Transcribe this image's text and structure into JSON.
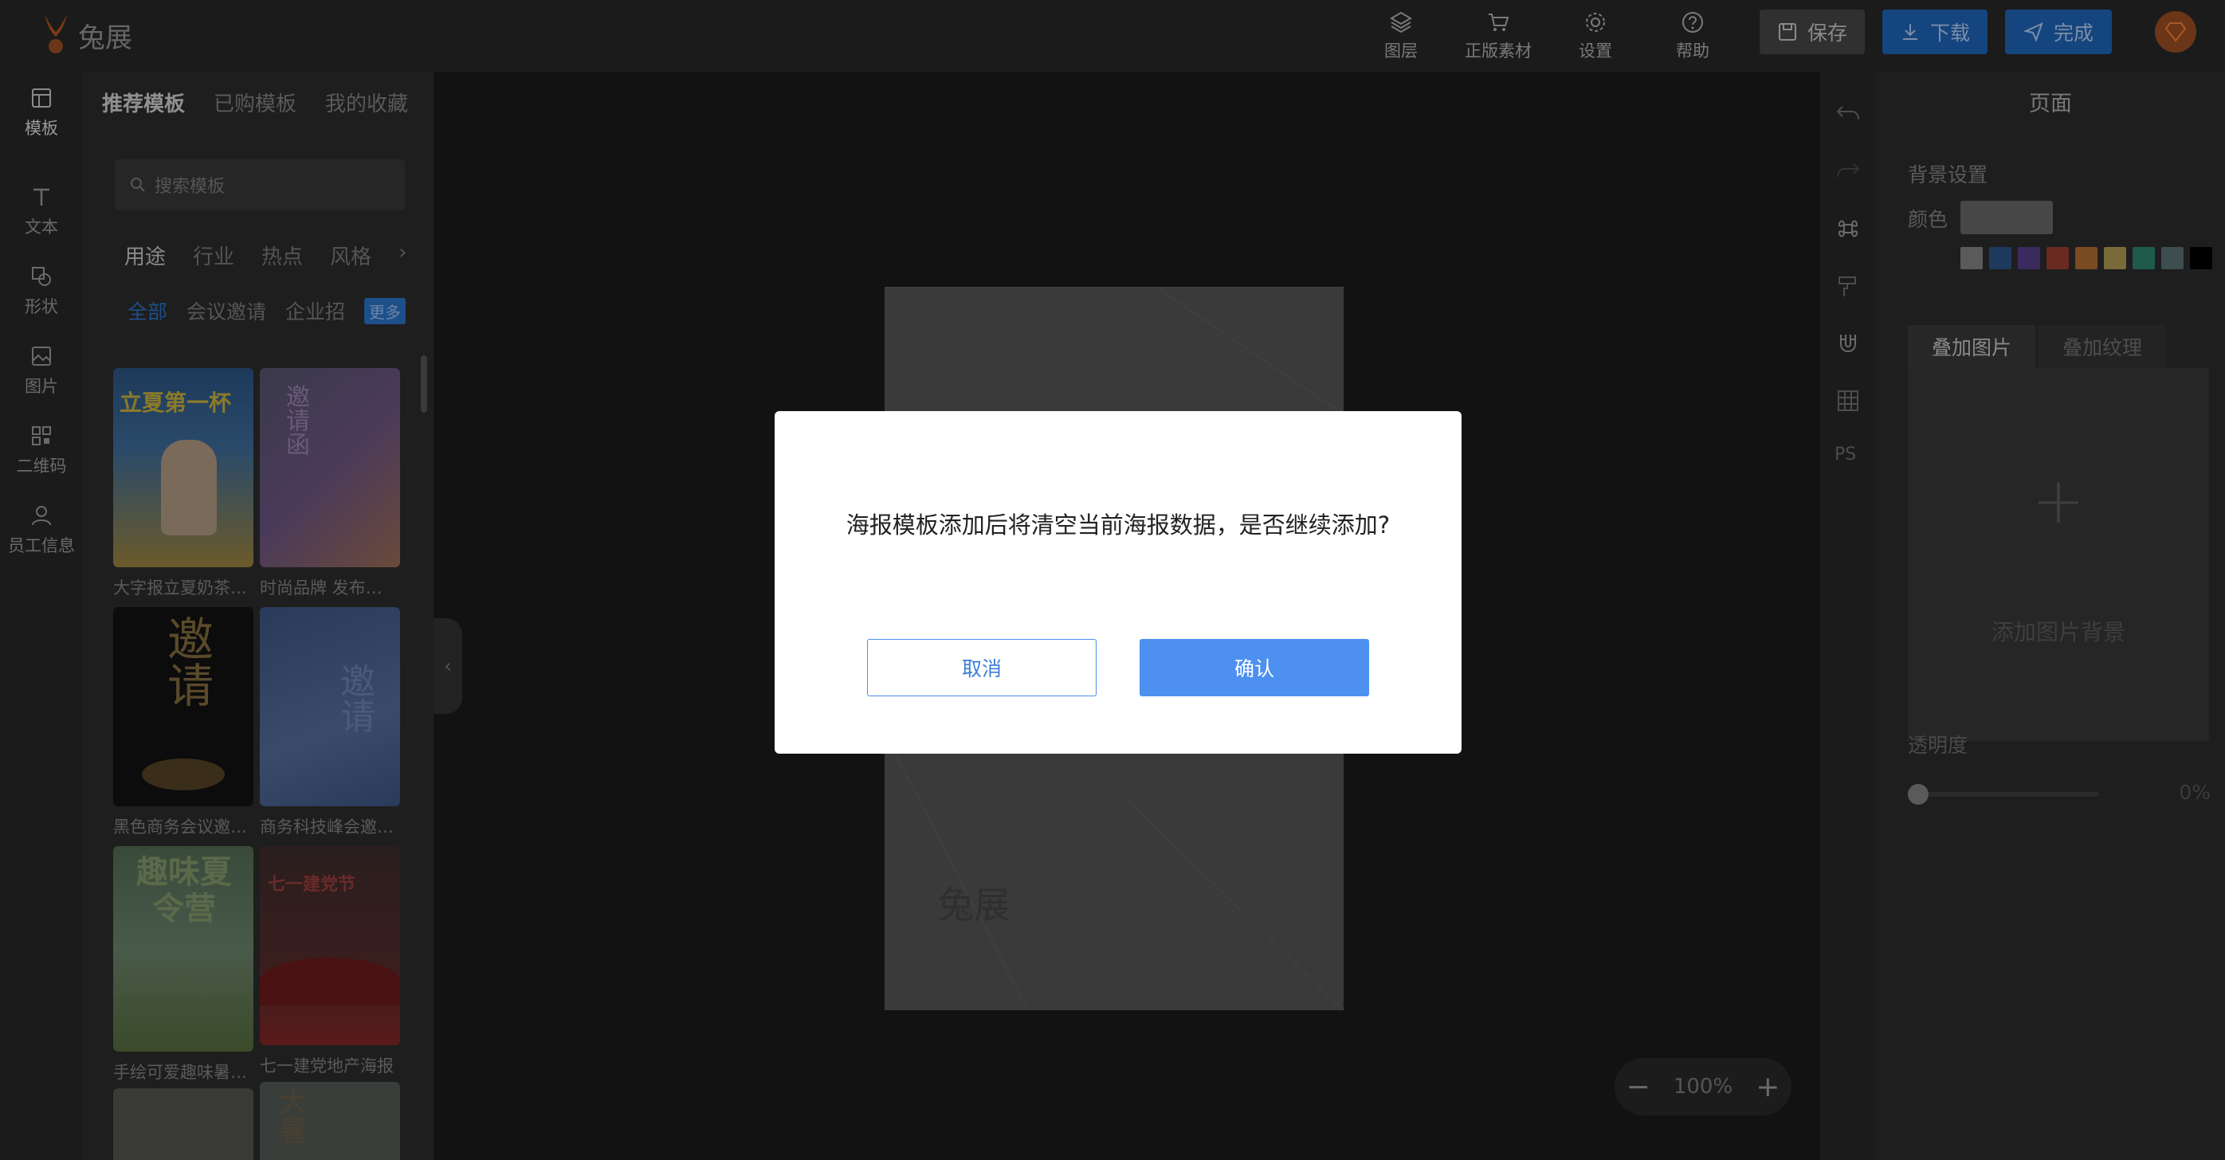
{
  "app": {
    "logo_text": "兔展"
  },
  "topbar": {
    "tools": [
      {
        "label": "图层",
        "icon": "layers-icon"
      },
      {
        "label": "正版素材",
        "icon": "cart-icon"
      },
      {
        "label": "设置",
        "icon": "gear-icon"
      },
      {
        "label": "帮助",
        "icon": "help-icon"
      }
    ],
    "save_label": "保存",
    "download_label": "下载",
    "done_label": "完成"
  },
  "leftnav": {
    "items": [
      {
        "label": "模板",
        "icon": "template-icon"
      },
      {
        "label": "文本",
        "icon": "text-icon"
      },
      {
        "label": "形状",
        "icon": "shape-icon"
      },
      {
        "label": "图片",
        "icon": "image-icon"
      },
      {
        "label": "二维码",
        "icon": "qrcode-icon"
      },
      {
        "label": "员工信息",
        "icon": "person-icon"
      }
    ]
  },
  "templates": {
    "tabs": [
      "推荐模板",
      "已购模板",
      "我的收藏"
    ],
    "search_placeholder": "搜索模板",
    "categories": [
      "用途",
      "行业",
      "热点",
      "风格"
    ],
    "tags": [
      "全部",
      "会议邀请",
      "企业招"
    ],
    "more_label": "更多",
    "cards": [
      {
        "caption": "大字报立夏奶茶…",
        "thumb_text": "立夏第一杯"
      },
      {
        "caption": "时尚品牌 发布…",
        "thumb_text": "邀请函"
      },
      {
        "caption": "黑色商务会议邀…",
        "thumb_text": "邀请"
      },
      {
        "caption": "商务科技峰会邀…",
        "thumb_text": "邀请"
      },
      {
        "caption": "手绘可爱趣味暑…",
        "thumb_text": "趣味夏令营"
      },
      {
        "caption": "七一建党地产海报",
        "thumb_text": "七一建党节"
      },
      {
        "caption": "",
        "thumb_text": ""
      },
      {
        "caption": "",
        "thumb_text": "大暑"
      }
    ]
  },
  "canvas": {
    "zoom_label": "100%",
    "watermark": "兔展"
  },
  "props": {
    "title": "页面",
    "bg_label": "背景设置",
    "color_label": "颜色",
    "swatches": [
      "#5a5a5a",
      "#1f3a5e",
      "#3a2a5e",
      "#6a2a22",
      "#7a4a22",
      "#7a6a3a",
      "#1f5a4a",
      "#3e4e4e",
      "#000000"
    ],
    "overlay_tabs": [
      "叠加图片",
      "叠加纹理"
    ],
    "add_bg_label": "添加图片背景",
    "opacity_label": "透明度",
    "opacity_value": "0%"
  },
  "modal": {
    "message": "海报模板添加后将清空当前海报数据，是否继续添加?",
    "cancel_label": "取消",
    "confirm_label": "确认"
  }
}
